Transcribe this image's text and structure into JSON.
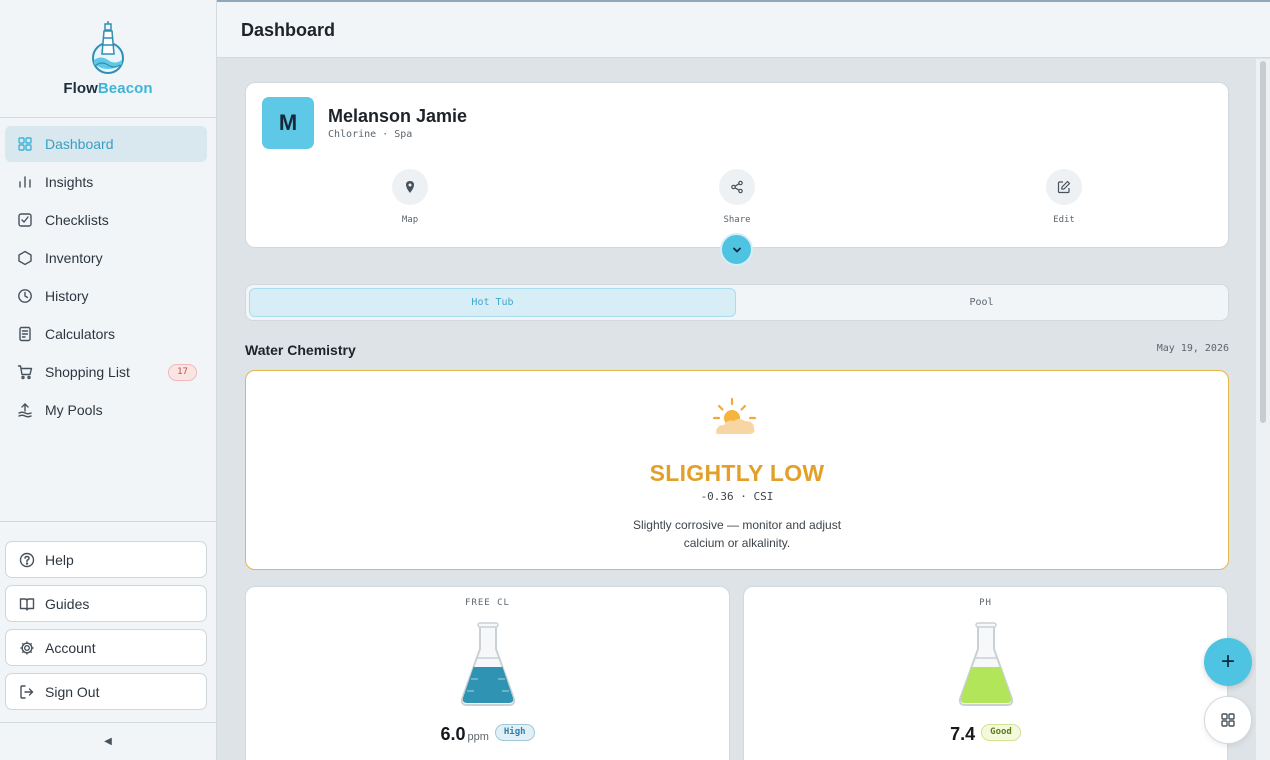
{
  "brand": {
    "part1": "Flow",
    "part2": "Beacon"
  },
  "nav": [
    {
      "label": "Dashboard",
      "icon": "dashboard-icon",
      "active": true
    },
    {
      "label": "Insights",
      "icon": "bar-chart-icon"
    },
    {
      "label": "Checklists",
      "icon": "checklist-icon"
    },
    {
      "label": "Inventory",
      "icon": "hexagon-icon"
    },
    {
      "label": "History",
      "icon": "clock-icon"
    },
    {
      "label": "Calculators",
      "icon": "calculator-icon"
    },
    {
      "label": "Shopping List",
      "icon": "cart-icon",
      "badge": "17"
    },
    {
      "label": "My Pools",
      "icon": "pool-icon"
    }
  ],
  "bottom_nav": [
    {
      "label": "Help",
      "icon": "help-icon"
    },
    {
      "label": "Guides",
      "icon": "book-icon"
    },
    {
      "label": "Account",
      "icon": "gear-icon"
    },
    {
      "label": "Sign Out",
      "icon": "sign-out-icon"
    }
  ],
  "header": {
    "title": "Dashboard"
  },
  "profile": {
    "initial": "M",
    "name": "Melanson Jamie",
    "subtitle": "Chlorine · Spa",
    "actions": [
      {
        "label": "Map",
        "icon": "map-pin-icon"
      },
      {
        "label": "Share",
        "icon": "share-icon"
      },
      {
        "label": "Edit",
        "icon": "edit-icon"
      }
    ]
  },
  "tabs": {
    "hot_tub": "Hot Tub",
    "pool": "Pool",
    "selected": "Hot Tub"
  },
  "section": {
    "title": "Water Chemistry",
    "date": "May 19, 2026"
  },
  "status": {
    "label": "SLIGHTLY LOW",
    "csi": "-0.36 · CSI",
    "description_line1": "Slightly corrosive — monitor and adjust",
    "description_line2": "calcium or alkalinity.",
    "accent_color": "#e2a02a"
  },
  "metrics": [
    {
      "label": "FREE CL",
      "value": "6.0",
      "unit": "ppm",
      "status": "High",
      "fill_color": "#2f94b3"
    },
    {
      "label": "PH",
      "value": "7.4",
      "unit": "",
      "status": "Good",
      "fill_color": "#b2e55a"
    }
  ],
  "fab": {
    "add_symbol": "+"
  },
  "colors": {
    "brand": "#3fb4d6",
    "accent": "#4fc3e2"
  }
}
